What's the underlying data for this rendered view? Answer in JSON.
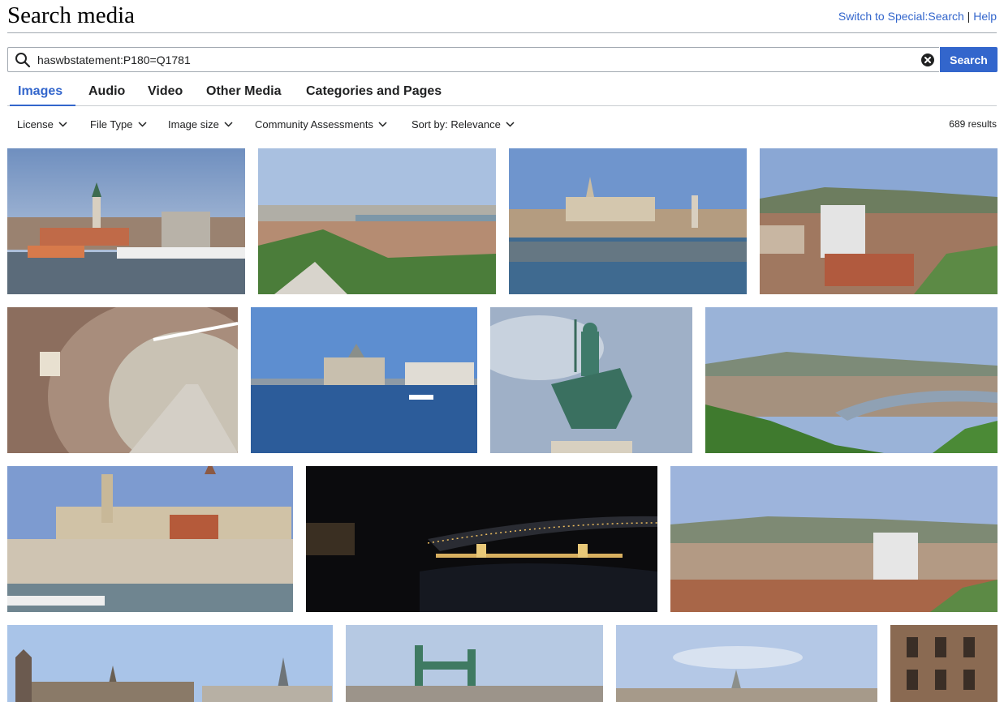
{
  "page": {
    "title": "Search media"
  },
  "top_links": {
    "switch_label": "Switch to Special:Search",
    "separator": "|",
    "help_label": "Help"
  },
  "search": {
    "query": "haswbstatement:P180=Q1781",
    "button_label": "Search"
  },
  "tabs": [
    {
      "label": "Images",
      "active": true
    },
    {
      "label": "Audio"
    },
    {
      "label": "Video"
    },
    {
      "label": "Other Media"
    },
    {
      "label": "Categories and Pages"
    }
  ],
  "filters": [
    {
      "label": "License"
    },
    {
      "label": "File Type"
    },
    {
      "label": "Image size"
    },
    {
      "label": "Community Assessments"
    },
    {
      "label": "Sort by: Relevance"
    }
  ],
  "results_count": "689 results",
  "colors": {
    "accent": "#3366cc",
    "text": "#202122",
    "border": "#a2a9b1"
  },
  "icons": {
    "search": "search-icon",
    "clear": "clear-icon",
    "dropdown": "chevron-down-icon"
  }
}
